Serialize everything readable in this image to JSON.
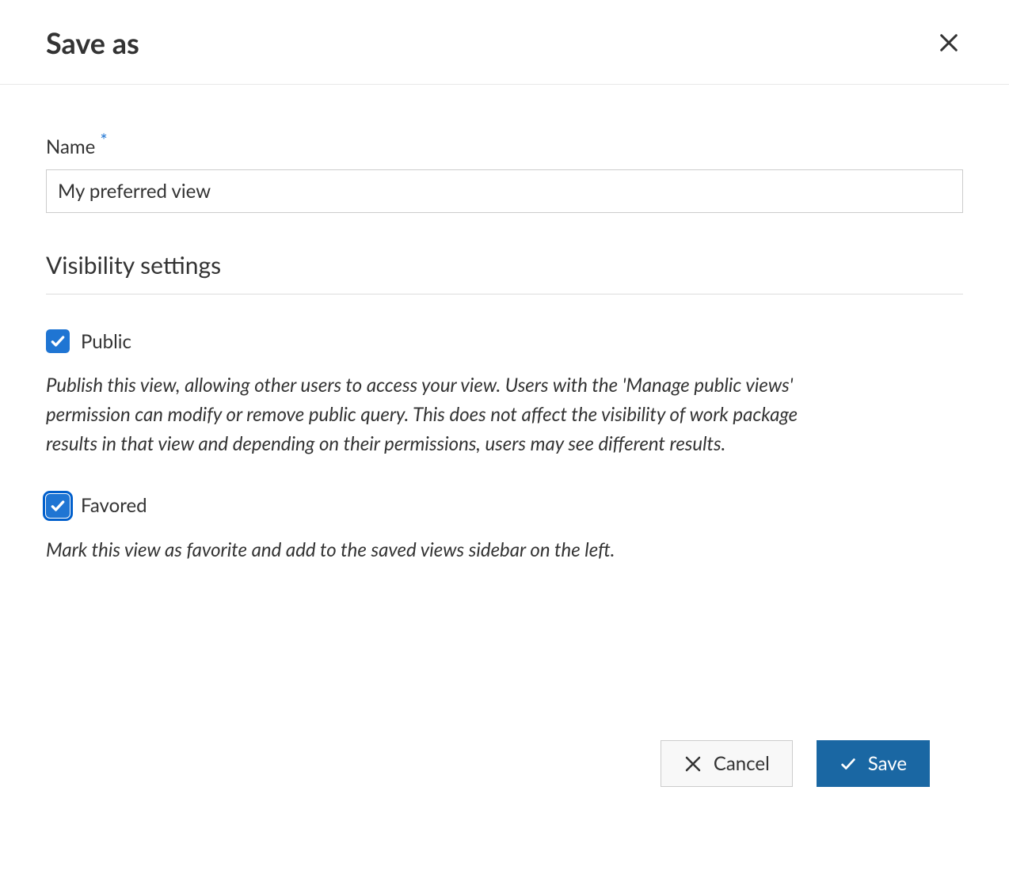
{
  "dialog": {
    "title": "Save as"
  },
  "fields": {
    "name": {
      "label": "Name",
      "required_mark": "*",
      "value": "My preferred view"
    }
  },
  "section": {
    "visibility_title": "Visibility settings"
  },
  "checkboxes": {
    "public": {
      "label": "Public",
      "checked": true,
      "description": "Publish this view, allowing other users to access your view. Users with the 'Manage public views' permission can modify or remove public query. This does not affect the visibility of work package results in that view and depending on their permissions, users may see different results."
    },
    "favored": {
      "label": "Favored",
      "checked": true,
      "focused": true,
      "description": "Mark this view as favorite and add to the saved views sidebar on the left."
    }
  },
  "buttons": {
    "cancel": "Cancel",
    "save": "Save"
  }
}
